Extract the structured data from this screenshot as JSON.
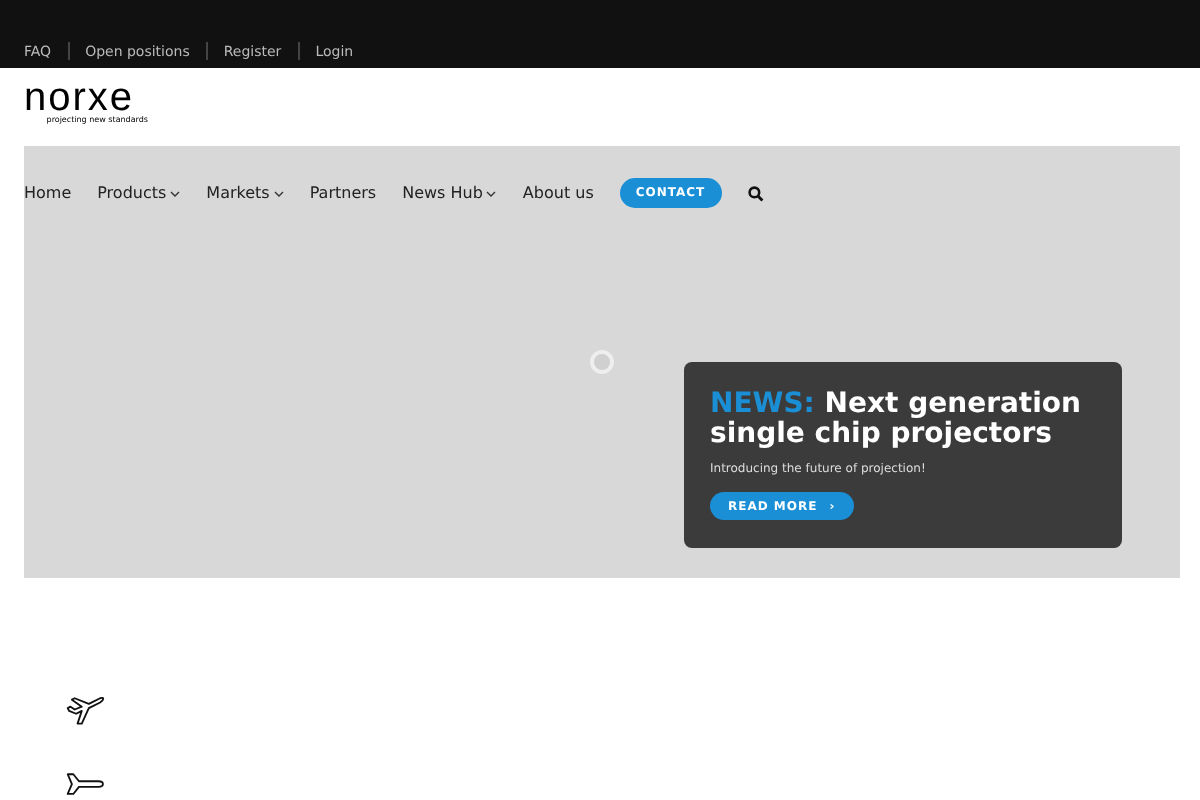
{
  "top_links": [
    "FAQ",
    "Open positions",
    "Register",
    "Login"
  ],
  "logo": {
    "name": "norxe",
    "tagline": "projecting new standards"
  },
  "nav": [
    {
      "label": "Home",
      "has_menu": false
    },
    {
      "label": "Products",
      "has_menu": true
    },
    {
      "label": "Markets",
      "has_menu": true
    },
    {
      "label": "Partners",
      "has_menu": false
    },
    {
      "label": "News Hub",
      "has_menu": true
    },
    {
      "label": "About us",
      "has_menu": false
    }
  ],
  "contact_button": "CONTACT",
  "news_card": {
    "tag": "NEWS:",
    "headline": "Next generation single chip projectors",
    "text": "Introducing the future of projection!",
    "button": "READ MORE",
    "button_arrow": "›"
  }
}
